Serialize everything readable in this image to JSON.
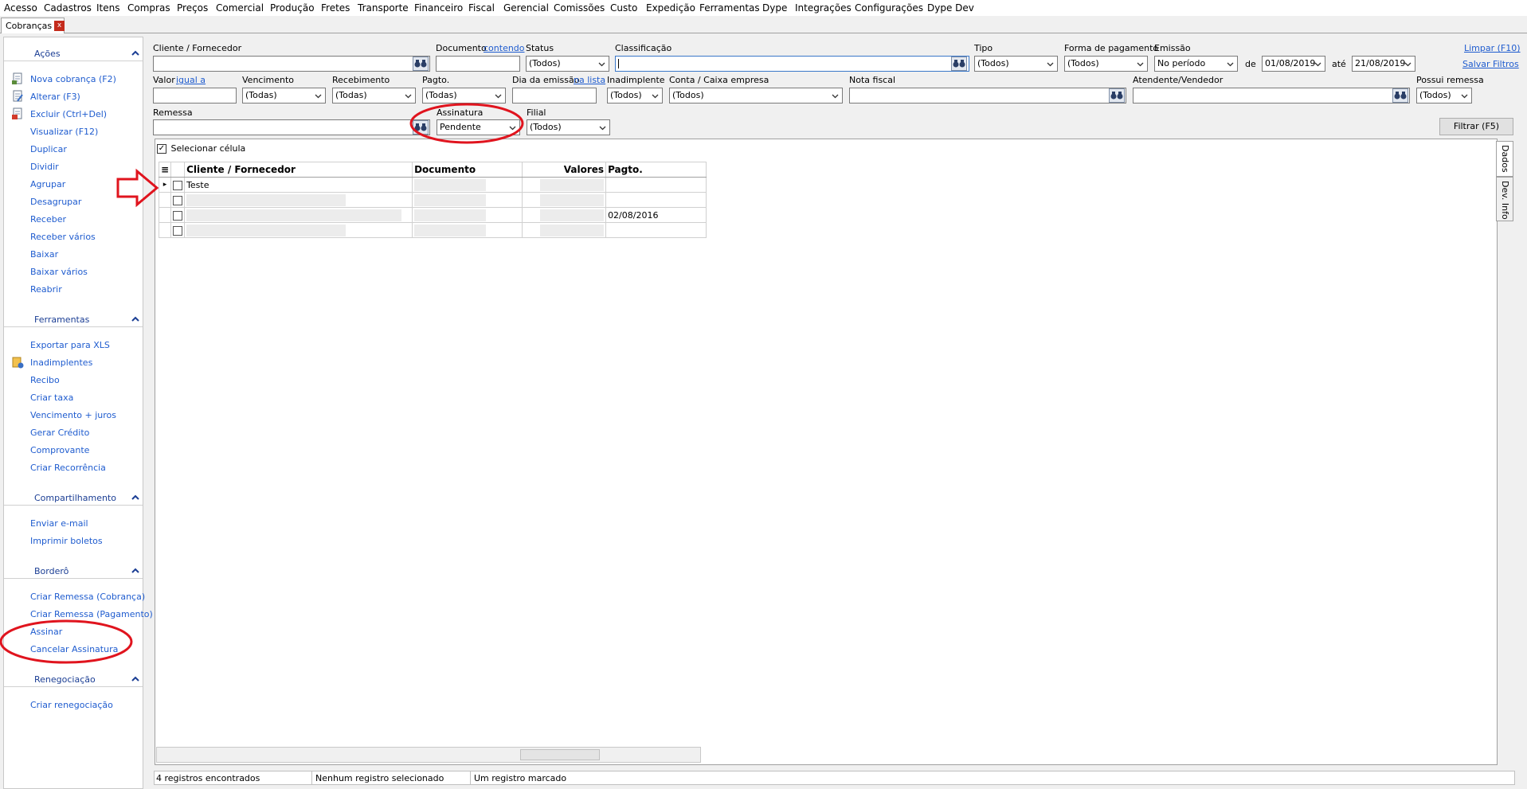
{
  "menu": [
    "Acesso",
    "Cadastros",
    "Itens",
    "Compras",
    "Preços",
    "Comercial",
    "Produção",
    "Fretes",
    "Transporte",
    "Financeiro",
    "Fiscal",
    "Gerencial",
    "Comissões",
    "Custo",
    "Expedição",
    "Ferramentas",
    "Dype",
    "Integrações",
    "Configurações",
    "Dype Dev"
  ],
  "tab": {
    "label": "Cobranças",
    "close": "x"
  },
  "sidebar": {
    "acoes": {
      "title": "Ações",
      "items": [
        "Nova cobrança (F2)",
        "Alterar (F3)",
        "Excluir (Ctrl+Del)",
        "Visualizar (F12)",
        "Duplicar",
        "Dividir",
        "Agrupar",
        "Desagrupar",
        "Receber",
        "Receber vários",
        "Baixar",
        "Baixar vários",
        "Reabrir"
      ]
    },
    "ferramentas": {
      "title": "Ferramentas",
      "items": [
        "Exportar para XLS",
        "Inadimplentes",
        "Recibo",
        "Criar taxa",
        "Vencimento + juros",
        "Gerar Crédito",
        "Comprovante",
        "Criar Recorrência"
      ]
    },
    "compartilhamento": {
      "title": "Compartilhamento",
      "items": [
        "Enviar e-mail",
        "Imprimir boletos"
      ]
    },
    "bordero": {
      "title": "Borderô",
      "items": [
        "Criar Remessa (Cobrança)",
        "Criar Remessa (Pagamento)",
        "Assinar",
        "Cancelar Assinatura"
      ]
    },
    "renegociacao": {
      "title": "Renegociação",
      "items": [
        "Criar renegociação"
      ]
    }
  },
  "filters": {
    "cliente": "Cliente / Fornecedor",
    "documento": "Documento",
    "documento_link": "contendo",
    "status": {
      "label": "Status",
      "value": "(Todos)"
    },
    "classificacao": "Classificação",
    "tipo": {
      "label": "Tipo",
      "value": "(Todos)"
    },
    "forma": {
      "label": "Forma de pagamento",
      "value": "(Todos)"
    },
    "emissao": {
      "label": "Emissão",
      "value": "No período",
      "de": "de",
      "de_value": "01/08/2019",
      "ate": "até",
      "ate_value": "21/08/2019"
    },
    "limpar": "Limpar (F10)",
    "salvar": "Salvar Filtros",
    "valor": "Valor",
    "valor_link": "igual a",
    "vencimento": {
      "label": "Vencimento",
      "value": "(Todas)"
    },
    "recebimento": {
      "label": "Recebimento",
      "value": "(Todas)"
    },
    "pagto": {
      "label": "Pagto.",
      "value": "(Todas)"
    },
    "dia_emissao": "Dia da emissão",
    "dia_link": "na lista",
    "inadimplente": {
      "label": "Inadimplente",
      "value": "(Todos)"
    },
    "conta": {
      "label": "Conta / Caixa empresa",
      "value": "(Todos)"
    },
    "nota": "Nota fiscal",
    "atendente": "Atendente/Vendedor",
    "remessa_flag": {
      "label": "Possui remessa",
      "value": "(Todos)"
    },
    "remessa": "Remessa",
    "assinatura": {
      "label": "Assinatura",
      "value": "Pendente"
    },
    "filial": {
      "label": "Filial",
      "value": "(Todos)"
    },
    "filtrar": "Filtrar (F5)"
  },
  "grid": {
    "select_cell": "Selecionar célula",
    "columns": [
      "Cliente / Fornecedor",
      "Documento",
      "Valores",
      "Pagto."
    ],
    "rows": [
      {
        "cliente": "Teste",
        "pagto": ""
      },
      {
        "cliente": "",
        "pagto": ""
      },
      {
        "cliente": "",
        "pagto": "02/08/2016"
      },
      {
        "cliente": "",
        "pagto": ""
      }
    ]
  },
  "side_tabs": [
    "Dados",
    "Dev. Info"
  ],
  "status": [
    "4 registros encontrados",
    "Nenhum registro selecionado",
    "Um registro marcado"
  ],
  "colors": {
    "link": "#1f5ccf",
    "group_title": "#1b3e94",
    "annotation": "#e0141e"
  }
}
